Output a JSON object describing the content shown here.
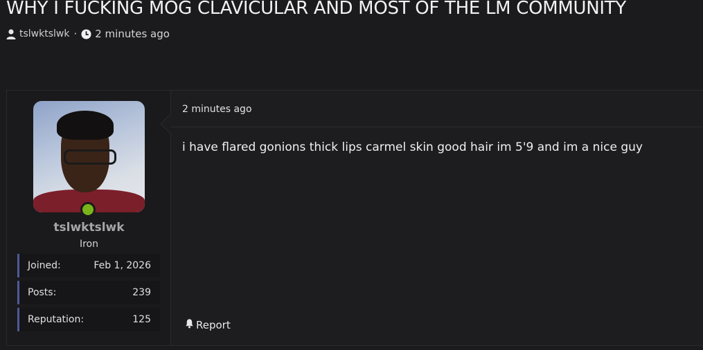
{
  "thread": {
    "title": "WHY I FUCKING MOG CLAVICULAR AND MOST OF THE LM COMMUNITY",
    "author": "tslwktslwk",
    "separator": "·",
    "time_ago": "2 minutes ago"
  },
  "post": {
    "date": "2 minutes ago",
    "body": "i have flared gonions thick lips carmel skin good hair im 5'9 and im a nice guy",
    "report_label": "Report"
  },
  "user": {
    "name": "tslwktslwk",
    "rank": "Iron",
    "online": true,
    "stats": {
      "joined_label": "Joined:",
      "joined_value": "Feb 1, 2026",
      "posts_label": "Posts:",
      "posts_value": "239",
      "rep_label": "Reputation:",
      "rep_value": "125"
    }
  },
  "icons": {
    "author": "user-icon",
    "time": "clock-icon",
    "report": "bell-icon"
  },
  "colors": {
    "online": "#7ab41b",
    "stat_accent": "#4e5a9b"
  }
}
